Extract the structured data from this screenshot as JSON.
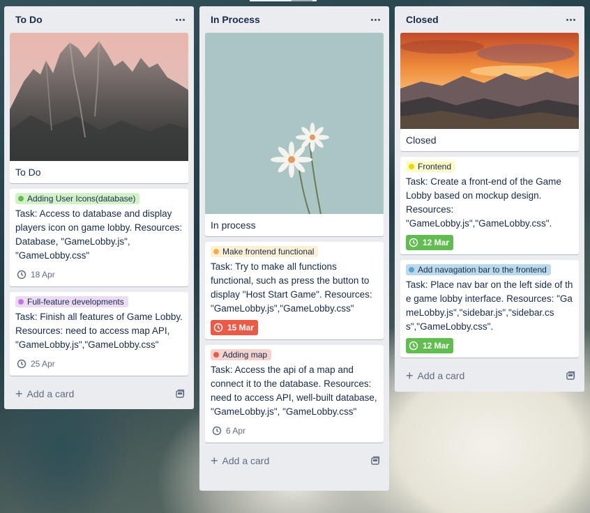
{
  "lists": [
    {
      "title": "To Do",
      "cover_title": "To Do",
      "cards": [
        {
          "label": {
            "text": "Adding User Icons(database)",
            "bg": "#d3f1c7",
            "dot": "#61bd4f"
          },
          "desc": "Task: Access to database and display players icon on game lobby. Resources: Database, \"GameLobby.js\", \"GameLobby.css\"",
          "due": "18 Apr"
        },
        {
          "label": {
            "text": "Full-feature developments",
            "bg": "#eddbf4",
            "dot": "#c377e0"
          },
          "desc": "Task: Finish all features of Game Lobby. Resources: need to access map API, \"GameLobby.js\",\"GameLobby.css\"",
          "due": "25 Apr"
        }
      ],
      "add_card": "Add a card"
    },
    {
      "title": "In Process",
      "cover_title": "In process",
      "cards": [
        {
          "label": {
            "text": "Make frontend functional",
            "bg": "#fdf0d3",
            "dot": "#ffab4a"
          },
          "desc": "Task: Try to make all functions functional, such as press the button to display \"Host Start Game\". Resources: \"GameLobby.js\",\"GameLobby.css\"",
          "due": "15 Mar"
        },
        {
          "label": {
            "text": "Adding map",
            "bg": "#f5d3ce",
            "dot": "#eb5a46"
          },
          "desc": "Task: Access the api of a map and connect it to the database. Resources: need to access API, well-built database, \"GameLobby.js\", \"GameLobby.css\"",
          "due": "6 Apr"
        }
      ],
      "add_card": "Add a card"
    },
    {
      "title": "Closed",
      "cover_title": "Closed",
      "cards": [
        {
          "label": {
            "text": "Frontend",
            "bg": "#fdfac5",
            "dot": "#f2d600"
          },
          "desc": "Task: Create a front-end of the Game Lobby based on mockup design. Resources: \"GameLobby.js\",\"GameLobby.css\".",
          "due": "12 Mar"
        },
        {
          "label": {
            "text": "Add navagation bar to the frontend",
            "bg": "#bcd9ea",
            "dot": "#5ba4cf"
          },
          "desc": "Task: Place nav bar on the left side of the game lobby interface. Resources: \"GameLobby.js\",\"sidebar.js\",\"sidebar.css\",\"GameLobby.css\".",
          "due": "12 Mar"
        }
      ],
      "add_card": "Add a card"
    }
  ],
  "icons": {
    "more": "more-horizontal-icon",
    "clock": "clock-icon",
    "plus": "plus-icon",
    "template": "card-template-icon"
  }
}
